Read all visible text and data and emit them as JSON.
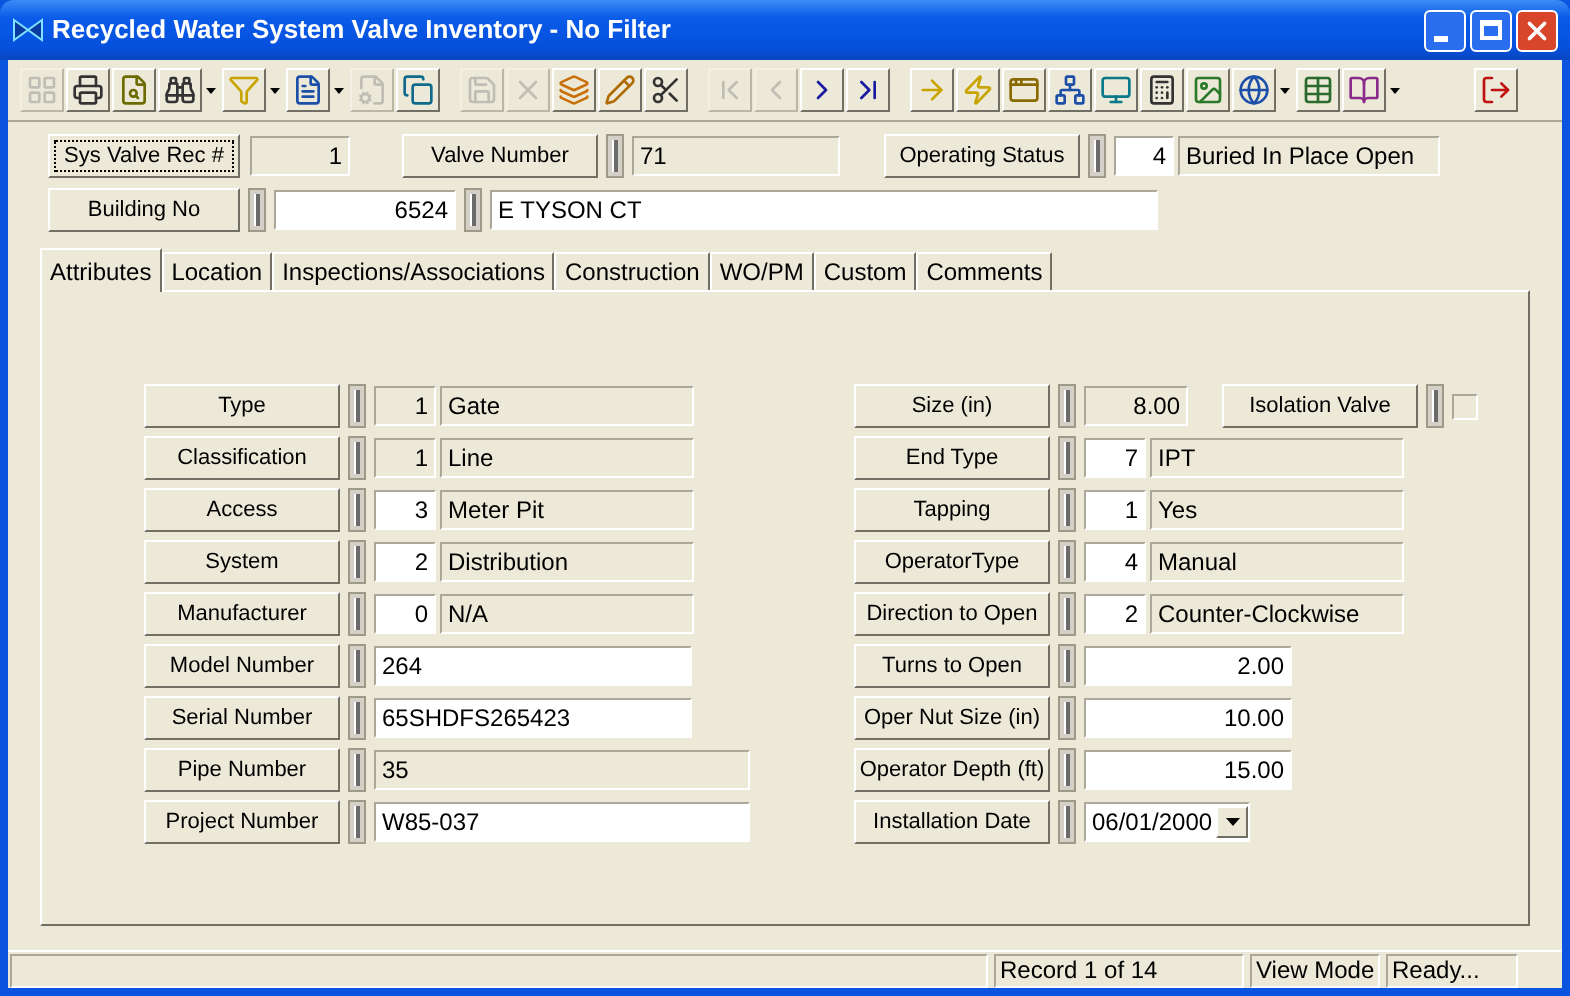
{
  "window": {
    "title": "Recycled Water System Valve Inventory - No Filter"
  },
  "toolbar": [
    [
      {
        "disabled": true,
        "dropdown": false
      },
      {
        "disabled": false,
        "dropdown": false
      },
      {
        "disabled": false,
        "dropdown": false
      },
      {
        "disabled": false,
        "dropdown": true
      },
      {
        "disabled": false,
        "dropdown": true
      },
      {
        "disabled": false,
        "dropdown": true
      },
      {
        "disabled": true,
        "dropdown": false
      },
      {
        "disabled": false,
        "dropdown": false
      }
    ],
    [
      {
        "disabled": true,
        "dropdown": false
      },
      {
        "disabled": true,
        "dropdown": false
      },
      {
        "disabled": false,
        "dropdown": false
      },
      {
        "disabled": false,
        "dropdown": false
      },
      {
        "disabled": false,
        "dropdown": false
      }
    ],
    [
      {
        "disabled": true,
        "dropdown": false
      },
      {
        "disabled": true,
        "dropdown": false
      },
      {
        "disabled": false,
        "dropdown": false
      },
      {
        "disabled": false,
        "dropdown": false
      }
    ],
    [
      {
        "disabled": false,
        "dropdown": false
      },
      {
        "disabled": false,
        "dropdown": false
      },
      {
        "disabled": false,
        "dropdown": false
      },
      {
        "disabled": false,
        "dropdown": false
      },
      {
        "disabled": false,
        "dropdown": false
      },
      {
        "disabled": false,
        "dropdown": false
      },
      {
        "disabled": false,
        "dropdown": false
      },
      {
        "disabled": false,
        "dropdown": true
      },
      {
        "disabled": false,
        "dropdown": false
      },
      {
        "disabled": false,
        "dropdown": true
      }
    ],
    [
      {
        "disabled": false,
        "dropdown": false
      }
    ]
  ],
  "header": [
    {
      "label": "Sys Valve Rec #",
      "focused": true,
      "kind": "record",
      "value": "1"
    },
    {
      "label": "Valve Number",
      "focused": false,
      "kind": "text",
      "value": "71"
    },
    {
      "label": "Operating Status",
      "focused": false,
      "kind": "code",
      "code": "4",
      "value": "Buried In Place Open"
    },
    {
      "label": "Building No",
      "focused": false,
      "kind": "address",
      "number": "6524",
      "street": "E TYSON CT"
    }
  ],
  "tabs": [
    {
      "label": "Attributes",
      "selected": true
    },
    {
      "label": "Location",
      "selected": false
    },
    {
      "label": "Inspections/Associations",
      "selected": false
    },
    {
      "label": "Construction",
      "selected": false
    },
    {
      "label": "WO/PM",
      "selected": false
    },
    {
      "label": "Custom",
      "selected": false
    },
    {
      "label": "Comments",
      "selected": false
    }
  ],
  "attributes": {
    "left": [
      {
        "label": "Type",
        "kind": "code",
        "code": "1",
        "editable": false,
        "value": "Gate"
      },
      {
        "label": "Classification",
        "kind": "code",
        "code": "1",
        "editable": false,
        "value": "Line"
      },
      {
        "label": "Access",
        "kind": "code",
        "code": "3",
        "editable": true,
        "value": "Meter Pit"
      },
      {
        "label": "System",
        "kind": "code",
        "code": "2",
        "editable": true,
        "value": "Distribution"
      },
      {
        "label": "Manufacturer",
        "kind": "code",
        "code": "0",
        "editable": true,
        "value": "N/A"
      },
      {
        "label": "Model Number",
        "kind": "text",
        "editable": true,
        "value": "264"
      },
      {
        "label": "Serial Number",
        "kind": "text",
        "editable": true,
        "value": "65SHDFS265423"
      },
      {
        "label": "Pipe Number",
        "kind": "long_text",
        "editable": false,
        "value": "35"
      },
      {
        "label": "Project Number",
        "kind": "long_text",
        "editable": true,
        "value": "W85-037"
      }
    ],
    "right": [
      {
        "label": "Size (in)",
        "kind": "short_number",
        "editable": false,
        "value": "8.00",
        "check": {
          "label": "Isolation Valve",
          "checked": false
        }
      },
      {
        "label": "End Type",
        "kind": "code",
        "code": "7",
        "editable": true,
        "value": "IPT"
      },
      {
        "label": "Tapping",
        "kind": "code",
        "code": "1",
        "editable": true,
        "value": "Yes"
      },
      {
        "label": "OperatorType",
        "kind": "code",
        "code": "4",
        "editable": true,
        "value": "Manual"
      },
      {
        "label": "Direction to Open",
        "kind": "code",
        "code": "2",
        "editable": true,
        "value": "Counter-Clockwise"
      },
      {
        "label": "Turns to Open",
        "kind": "number",
        "editable": true,
        "value": "2.00"
      },
      {
        "label": "Oper Nut Size (in)",
        "kind": "number",
        "editable": true,
        "value": "10.00"
      },
      {
        "label": "Operator Depth (ft)",
        "kind": "number",
        "editable": true,
        "value": "15.00"
      },
      {
        "label": "Installation Date",
        "kind": "date",
        "editable": true,
        "value": "06/01/2000"
      }
    ]
  },
  "status_bar": [
    "Record 1 of 14",
    "View Mode",
    "Ready..."
  ]
}
